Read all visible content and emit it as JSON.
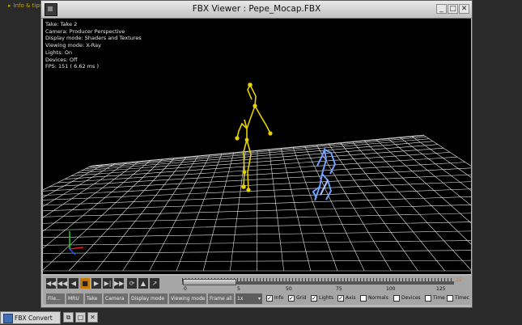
{
  "background": {
    "tip_label": "Info & tips"
  },
  "window": {
    "title": "FBX Viewer : Pepe_Mocap.FBX",
    "controls": {
      "minimize": "_",
      "restore": "□",
      "close": "✕"
    }
  },
  "overlay_info": [
    "Take: Take 2",
    "Camera: Producer Perspective",
    "Display mode: Shaders and Textures",
    "Viewing mode: X-Ray",
    "Lights: On",
    "Devices: Off",
    "FPS: 151 ( 6.62 ms )"
  ],
  "playback": {
    "buttons": [
      {
        "name": "goto-start-button",
        "label": "◀◀",
        "icon": "rewind-to-start-icon"
      },
      {
        "name": "prev-key-button",
        "label": "◀◀",
        "icon": "previous-key-icon"
      },
      {
        "name": "play-backward-button",
        "label": "◀",
        "icon": "play-backward-icon"
      },
      {
        "name": "stop-button",
        "label": "■",
        "icon": "stop-icon"
      },
      {
        "name": "play-forward-button",
        "label": "▶",
        "icon": "play-icon"
      },
      {
        "name": "next-frame-button",
        "label": "▶|",
        "icon": "next-frame-icon"
      },
      {
        "name": "goto-end-button",
        "label": "▶▶",
        "icon": "forward-to-end-icon"
      },
      {
        "name": "loop-button",
        "label": "⟳",
        "icon": "loop-icon"
      },
      {
        "name": "eject-button",
        "label": "▲",
        "icon": "eject-icon"
      },
      {
        "name": "export-button",
        "label": "↗",
        "icon": "export-icon"
      }
    ],
    "timeline": {
      "labels": [
        "0",
        "5",
        "50",
        "75",
        "100",
        "125"
      ],
      "end_frame": "22",
      "current_fraction": 0.2
    }
  },
  "bottom_bar": {
    "buttons": [
      "File...",
      "MRU",
      "Take",
      "Camera",
      "Display mode",
      "Viewing mode",
      "Frame all"
    ],
    "speed_value": "1x",
    "toggles": [
      {
        "label": "Info",
        "checked": true
      },
      {
        "label": "Grid",
        "checked": true
      },
      {
        "label": "Lights",
        "checked": true
      },
      {
        "label": "Axis",
        "checked": true
      },
      {
        "label": "Normals",
        "checked": false
      },
      {
        "label": "Devices",
        "checked": false
      },
      {
        "label": "Time",
        "checked": false
      },
      {
        "label": "Timec",
        "checked": false
      }
    ]
  },
  "taskbar": {
    "item_label": "FBX Convert"
  },
  "colors": {
    "skeleton_yellow": "#e6d200",
    "skeleton_blue": "#6fa0ff",
    "grid": "#ffffff"
  }
}
